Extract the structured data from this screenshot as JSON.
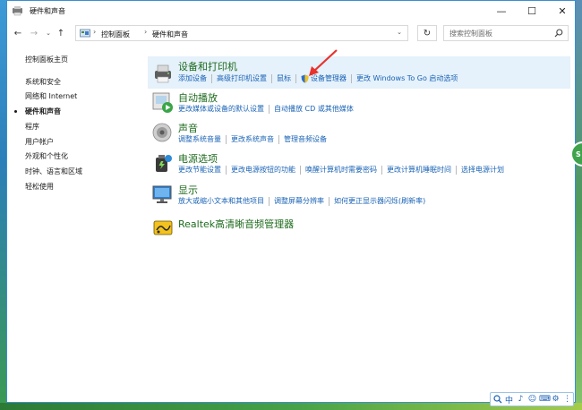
{
  "window": {
    "title": "硬件和声音",
    "controls": {
      "minimize": "—",
      "maximize": "☐",
      "close": "✕"
    }
  },
  "address": {
    "crumbs": [
      "控制面板",
      "硬件和声音"
    ],
    "search_placeholder": "搜索控制面板"
  },
  "sidebar": {
    "items": [
      {
        "label": "控制面板主页",
        "active": false
      },
      {
        "label": "系统和安全",
        "active": false
      },
      {
        "label": "网络和 Internet",
        "active": false
      },
      {
        "label": "硬件和声音",
        "active": true
      },
      {
        "label": "程序",
        "active": false
      },
      {
        "label": "用户帐户",
        "active": false
      },
      {
        "label": "外观和个性化",
        "active": false
      },
      {
        "label": "时钟、语言和区域",
        "active": false
      },
      {
        "label": "轻松使用",
        "active": false
      }
    ]
  },
  "categories": [
    {
      "title": "设备和打印机",
      "icon": "printer-icon",
      "links": [
        "添加设备",
        "高级打印机设置",
        "鼠标",
        "设备管理器",
        "更改 Windows To Go 启动选项"
      ]
    },
    {
      "title": "自动播放",
      "icon": "autoplay-icon",
      "links": [
        "更改媒体或设备的默认设置",
        "自动播放 CD 或其他媒体"
      ]
    },
    {
      "title": "声音",
      "icon": "speaker-icon",
      "links": [
        "调整系统音量",
        "更改系统声音",
        "管理音频设备"
      ]
    },
    {
      "title": "电源选项",
      "icon": "power-icon",
      "links": [
        "更改节能设置",
        "更改电源按钮的功能",
        "唤醒计算机时需要密码",
        "更改计算机睡眠时间",
        "选择电源计划"
      ]
    },
    {
      "title": "显示",
      "icon": "monitor-icon",
      "links": [
        "放大或缩小文本和其他项目",
        "调整屏幕分辨率",
        "如何更正显示器闪烁(刷新率)"
      ]
    },
    {
      "title": "Realtek高清晰音频管理器",
      "icon": "realtek-icon",
      "links": []
    }
  ],
  "side_badge": "S",
  "tray": [
    "中",
    "♪",
    "☺",
    "⌨",
    "⚙",
    "⋮"
  ],
  "colors": {
    "link": "#1a63b5",
    "category_title": "#1e6b1e",
    "highlight": "#e5f1fb",
    "arrow": "#e8322b"
  }
}
